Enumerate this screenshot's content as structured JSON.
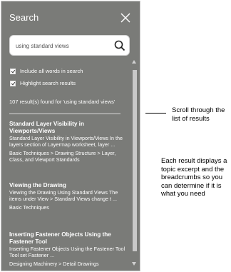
{
  "panel": {
    "title": "Search",
    "search": {
      "value": "using standard views",
      "placeholder": ""
    },
    "options": [
      {
        "label": "Include all words in search",
        "checked": true
      },
      {
        "label": "Highlight search results",
        "checked": true
      }
    ],
    "result_count": "107 result(s) found for 'using standard views'",
    "results": [
      {
        "title": "Standard Layer Visibility in Viewports/Views",
        "excerpt": "Standard Layer Visibility in Viewports/Views In the layers section of Layermap worksheet, layer ...",
        "breadcrumbs": "Basic Techniques > Drawing Structure > Layer, Class, and Viewport Standards"
      },
      {
        "title": "Viewing the Drawing",
        "excerpt": "Viewing the Drawing Using Standard Views The items under View > Standard Views change t ...",
        "breadcrumbs": "Basic Techniques"
      },
      {
        "title": "Inserting Fastener Objects Using the Fastener Tool",
        "excerpt": "Inserting Fastener Objects Using the Fastener Tool Tool set Fastener ...",
        "breadcrumbs": "Designing Machinery > Detail Drawings"
      }
    ]
  },
  "callouts": {
    "scroll": "Scroll through the list of results",
    "result": "Each result displays a topic excerpt and the breadcrumbs so you can determine if it is what you need"
  }
}
